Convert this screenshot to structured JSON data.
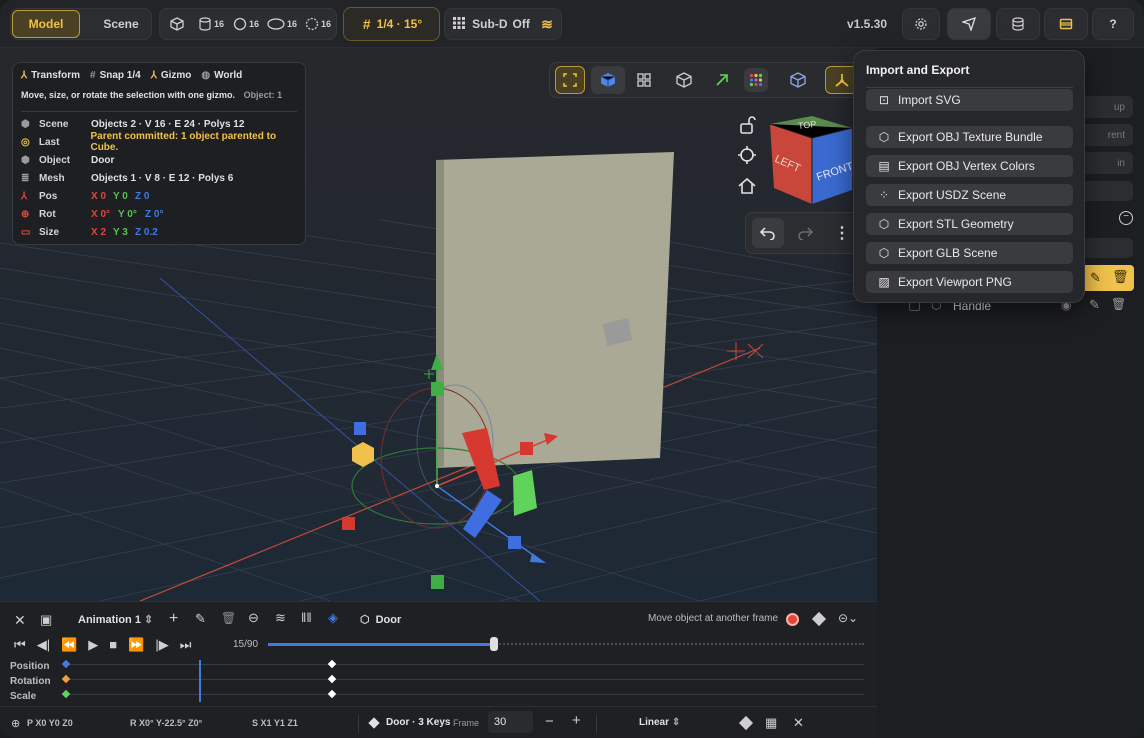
{
  "topbar": {
    "mode_tabs": [
      "Model",
      "Scene"
    ],
    "primitive_counts": [
      "16",
      "16",
      "16",
      "16"
    ],
    "snap_label": "1/4 · 15°",
    "subd_label": "Sub-D",
    "subd_state": "Off",
    "version": "v1.5.30"
  },
  "info": {
    "header": {
      "transform": "Transform",
      "snap": "Snap 1/4",
      "gizmo": "Gizmo",
      "world": "World"
    },
    "hint": "Move, size, or rotate the selection with one gizmo.",
    "object_count": "Object: 1",
    "rows": {
      "scene": {
        "label": "Scene",
        "value": "Objects 2 · V 16 · E 24 · Polys 12"
      },
      "last": {
        "label": "Last",
        "value": "Parent committed: 1 object parented to Cube."
      },
      "object": {
        "label": "Object",
        "value": "Door"
      },
      "mesh": {
        "label": "Mesh",
        "value": "Objects 1 · V 8 · E 12 · Polys 6"
      },
      "pos": {
        "label": "Pos",
        "x": "X 0",
        "y": "Y 0",
        "z": "Z 0"
      },
      "rot": {
        "label": "Rot",
        "x": "X 0°",
        "y": "Y 0°",
        "z": "Z 0°"
      },
      "size": {
        "label": "Size",
        "x": "X 2",
        "y": "Y 3",
        "z": "Z 0.2"
      }
    }
  },
  "viewcube": {
    "top": "TOP",
    "left": "LEFT",
    "front": "FRONT"
  },
  "popup": {
    "title": "Import and Export",
    "items": [
      "Import SVG",
      "Export OBJ Texture Bundle",
      "Export OBJ Vertex Colors",
      "Export USDZ Scene",
      "Export STL Geometry",
      "Export GLB Scene",
      "Export Viewport PNG"
    ]
  },
  "outliner": {
    "partial": [
      "up",
      "rent",
      "in"
    ],
    "handle_label": "Handle"
  },
  "animation": {
    "clip": "Animation 1",
    "object": "Door",
    "hint": "Move object at another frame",
    "frame_counter": "15/90",
    "progress": 0.38,
    "tracks": [
      "Position",
      "Rotation",
      "Scale"
    ],
    "status_pos": "P X0 Y0 Z0",
    "status_rot": "R X0° Y-22.5° Z0°",
    "status_scale": "S X1 Y1 Z1",
    "keys_label": "Door · 3 Keys",
    "frame_label": "Frame",
    "frame_value": "30",
    "interp": "Linear"
  },
  "colors": {
    "accent": "#f0c24b",
    "x": "#e0473c",
    "y": "#56c251",
    "z": "#3f7be0",
    "panel": "#1d1e21"
  }
}
